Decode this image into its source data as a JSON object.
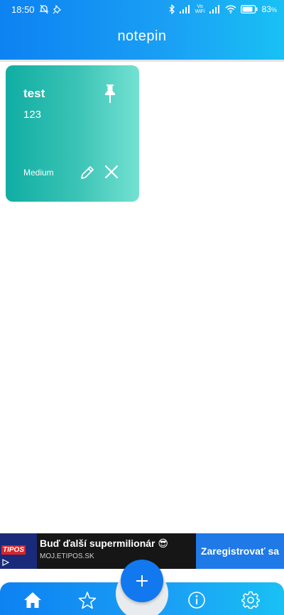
{
  "status_bar": {
    "time": "18:50",
    "network_label_top": "Vo",
    "network_label_bottom": "WiFi",
    "battery_percent": "83",
    "battery_unit": "%"
  },
  "app": {
    "title": "notepin"
  },
  "notes": [
    {
      "title": "test",
      "body": "123",
      "priority": "Medium",
      "pinned": true
    }
  ],
  "ad": {
    "logo_text": "TIPOS",
    "headline": "Buď ďalší supermilionár 😎",
    "url": "MOJ.ETIPOS.SK",
    "cta": "Zaregistrovať sa"
  },
  "bottom_nav": {
    "items": [
      "home-icon",
      "star-icon",
      "info-icon",
      "gear-icon"
    ],
    "active": "home-icon",
    "fab_icon": "plus-icon"
  },
  "colors": {
    "header_start": "#0d82f2",
    "header_end": "#19c1f4",
    "card_start": "#10ada3",
    "card_end": "#74e1d2",
    "fab": "#1178ef",
    "ad_cta": "#1f79e6"
  }
}
